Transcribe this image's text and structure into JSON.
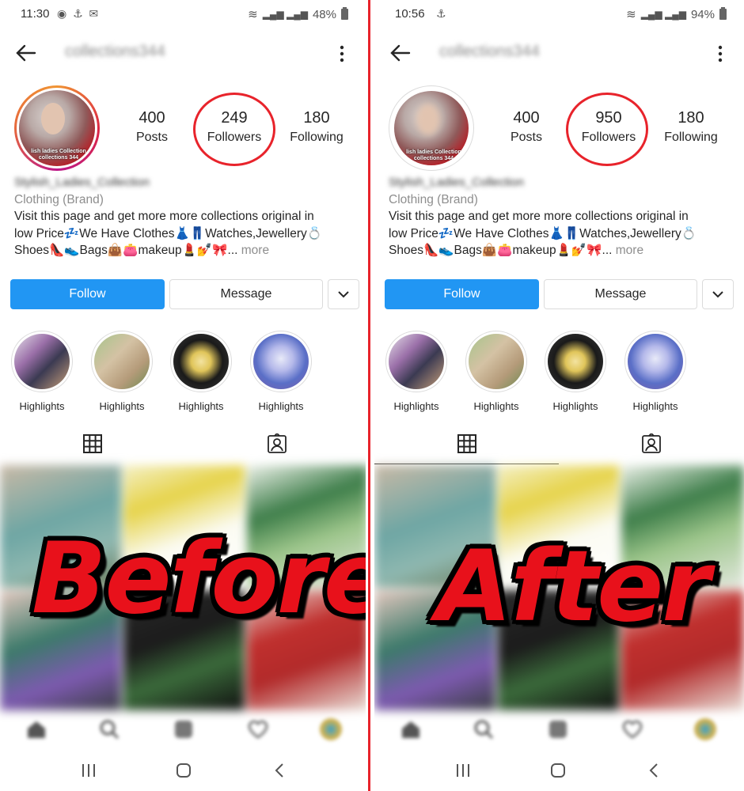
{
  "colors": {
    "accent_blue": "#2196f3",
    "annotation_red": "#e8232b",
    "text": "#262626",
    "muted": "#8e8e8e"
  },
  "left": {
    "status": {
      "time": "11:30",
      "battery": "48%"
    },
    "profile": {
      "username": "collections344",
      "display_name": "Stylish_Ladies_Collection",
      "avatar_text": "lish ladies Collection collections 344",
      "stats": [
        {
          "value": "400",
          "label": "Posts"
        },
        {
          "value": "249",
          "label": "Followers"
        },
        {
          "value": "180",
          "label": "Following"
        }
      ],
      "category": "Clothing (Brand)",
      "bio_line1": "Visit this page and get more more collections original in",
      "bio_line2": "low Price💤We Have Clothes👗👖Watches,Jewellery💍",
      "bio_line3": "Shoes👠👟Bags👜👛makeup💄💅🎀...",
      "more": "more"
    },
    "buttons": {
      "follow": "Follow",
      "message": "Message"
    },
    "highlights": [
      "Highlights",
      "Highlights",
      "Highlights",
      "Highlights"
    ],
    "overlay_label": "Before"
  },
  "right": {
    "status": {
      "time": "10:56",
      "battery": "94%"
    },
    "profile": {
      "username": "collections344",
      "display_name": "Stylish_Ladies_Collection",
      "avatar_text": "lish ladies Collection collections 344",
      "stats": [
        {
          "value": "400",
          "label": "Posts"
        },
        {
          "value": "950",
          "label": "Followers"
        },
        {
          "value": "180",
          "label": "Following"
        }
      ],
      "category": "Clothing (Brand)",
      "bio_line1": "Visit this page and get more more collections original in",
      "bio_line2": "low Price💤We Have Clothes👗👖Watches,Jewellery💍",
      "bio_line3": "Shoes👠👟Bags👜👛makeup💄💅🎀...",
      "more": "more"
    },
    "buttons": {
      "follow": "Follow",
      "message": "Message"
    },
    "highlights": [
      "Highlights",
      "Highlights",
      "Highlights",
      "Highlights"
    ],
    "overlay_label": "After"
  }
}
